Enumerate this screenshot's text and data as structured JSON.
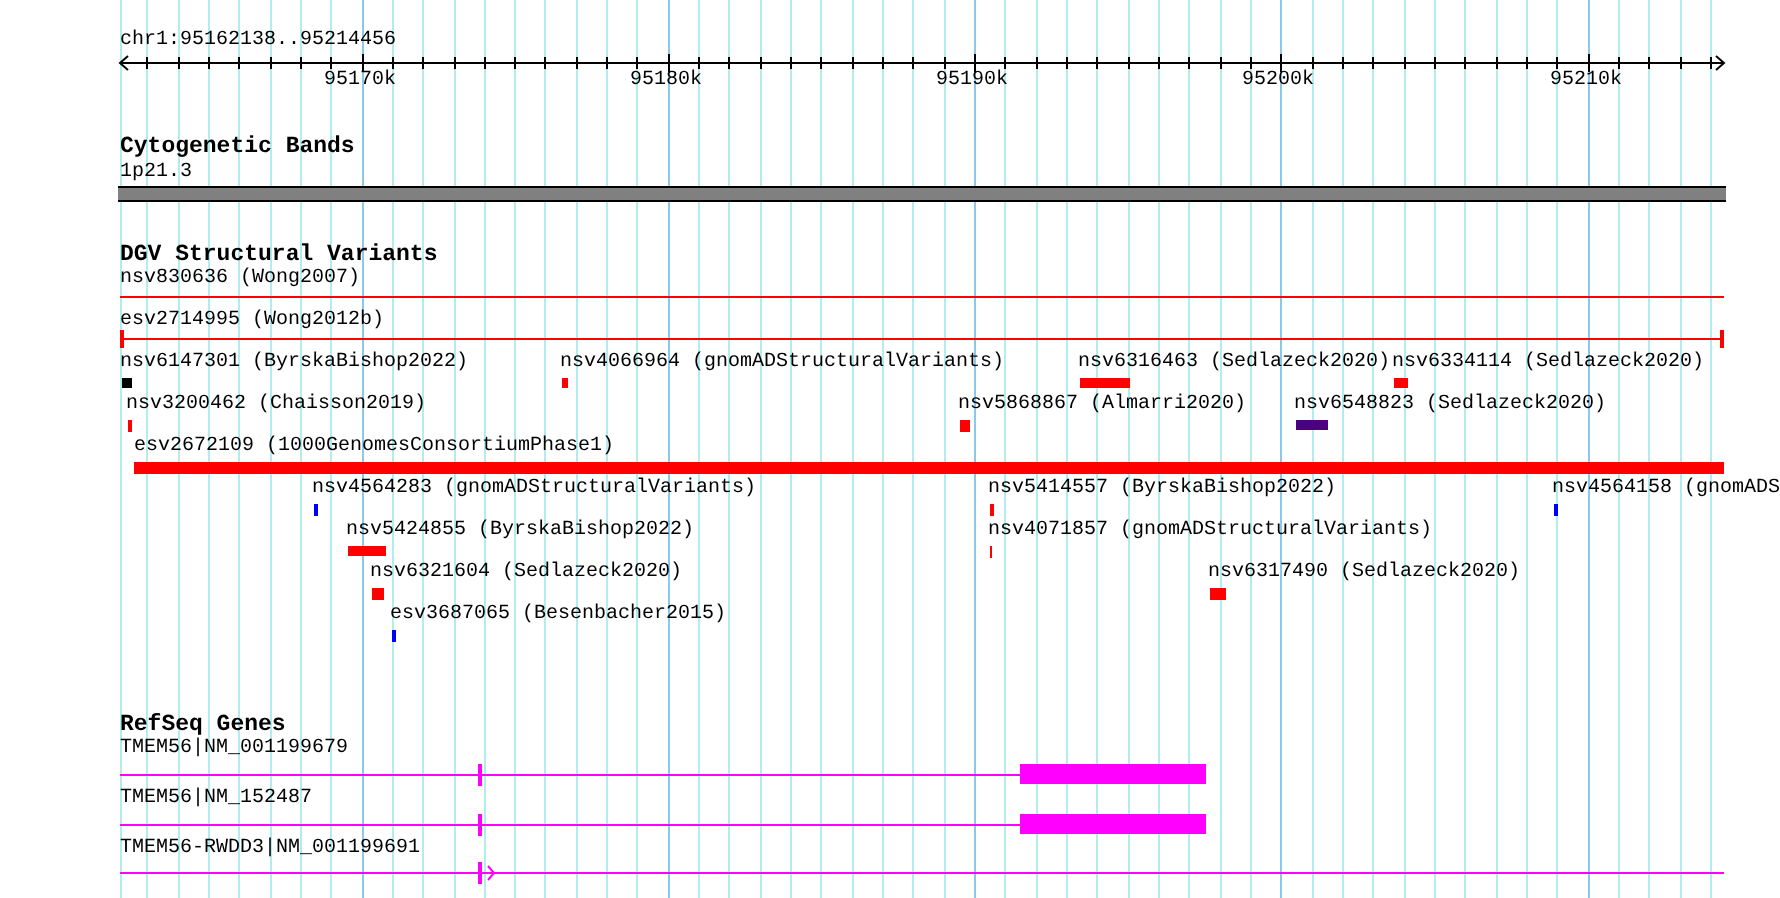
{
  "ruler": {
    "location": "chr1:95162138..95214456",
    "tick_labels": [
      "95170k",
      "95180k",
      "95190k",
      "95200k",
      "95210k"
    ]
  },
  "cytogenetic_bands": {
    "title": "Cytogenetic Bands",
    "band_label": "1p21.3"
  },
  "dgv": {
    "title": "DGV Structural Variants",
    "features": [
      {
        "kind": "span",
        "label": "nsv830636 (Wong2007)",
        "color": "#ff0000"
      },
      {
        "kind": "span",
        "label": "esv2714995 (Wong2012b)",
        "color": "#ff0000"
      },
      {
        "kind": "bar",
        "label": "nsv6147301 (ByrskaBishop2022)",
        "color": "#000000"
      },
      {
        "kind": "bar",
        "label": "nsv4066964 (gnomADStructuralVariants)",
        "color": "#ff0000"
      },
      {
        "kind": "bar",
        "label": "nsv6316463 (Sedlazeck2020)",
        "color": "#ff0000"
      },
      {
        "kind": "bar",
        "label": "nsv6334114 (Sedlazeck2020)",
        "color": "#ff0000"
      },
      {
        "kind": "bar",
        "label": "nsv3200462 (Chaisson2019)",
        "color": "#ff0000"
      },
      {
        "kind": "bar",
        "label": "nsv5868867 (Almarri2020)",
        "color": "#ff0000"
      },
      {
        "kind": "bar",
        "label": "nsv6548823 (Sedlazeck2020)",
        "color": "#4b0082"
      },
      {
        "kind": "bar",
        "label": "esv2672109 (1000GenomesConsortiumPhase1)",
        "color": "#ff0000"
      },
      {
        "kind": "bar",
        "label": "nsv4564283 (gnomADStructuralVariants)",
        "color": "#0000ff"
      },
      {
        "kind": "bar",
        "label": "nsv5414557 (ByrskaBishop2022)",
        "color": "#ff0000"
      },
      {
        "kind": "bar",
        "label": "nsv4564158 (gnomADS",
        "color": "#0000ff"
      },
      {
        "kind": "bar",
        "label": "nsv5424855 (ByrskaBishop2022)",
        "color": "#ff0000"
      },
      {
        "kind": "bar",
        "label": "nsv4071857 (gnomADStructuralVariants)",
        "color": "#ff0000"
      },
      {
        "kind": "bar",
        "label": "nsv6321604 (Sedlazeck2020)",
        "color": "#ff0000"
      },
      {
        "kind": "bar",
        "label": "nsv6317490 (Sedlazeck2020)",
        "color": "#ff0000"
      },
      {
        "kind": "bar",
        "label": "esv3687065 (Besenbacher2015)",
        "color": "#0000ff"
      }
    ]
  },
  "refseq_genes": {
    "title": "RefSeq Genes",
    "transcripts": [
      {
        "label": "TMEM56|NM_001199679"
      },
      {
        "label": "TMEM56|NM_152487"
      },
      {
        "label": "TMEM56-RWDD3|NM_001199691"
      }
    ]
  }
}
